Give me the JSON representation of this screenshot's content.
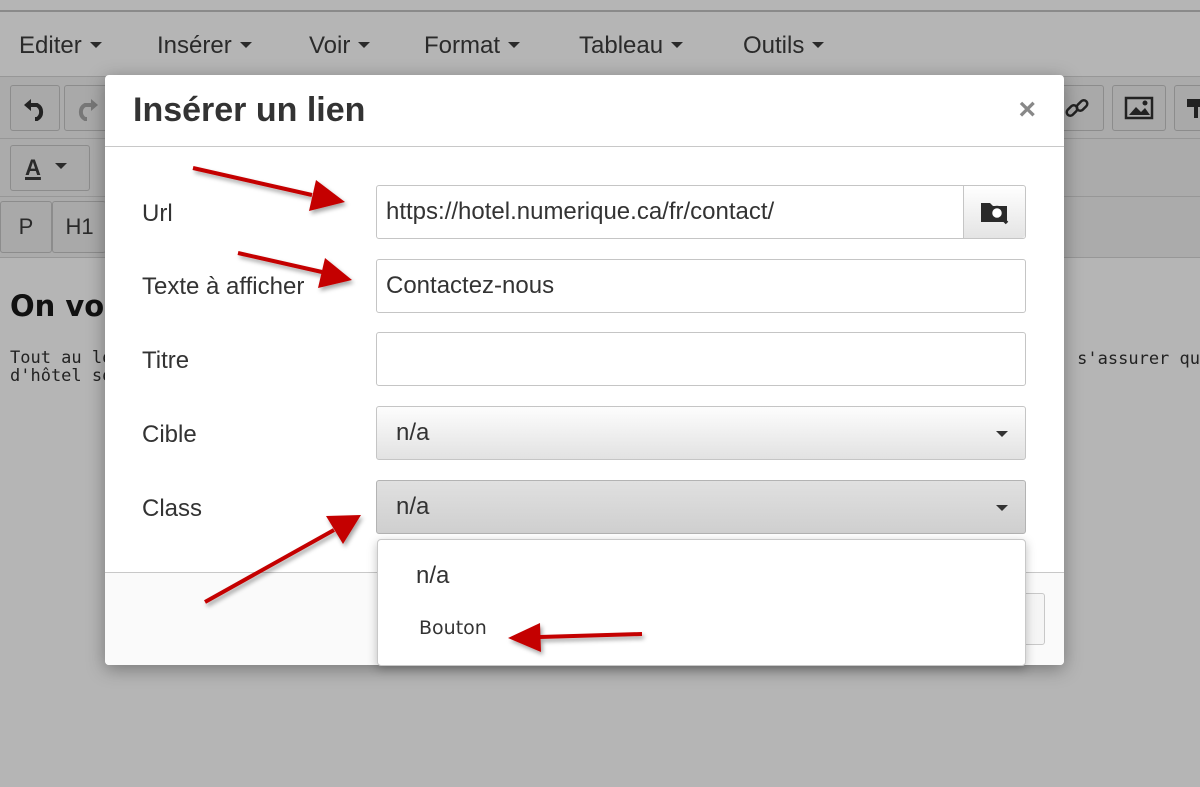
{
  "menubar": {
    "items": [
      {
        "label": "Editer"
      },
      {
        "label": "Insérer"
      },
      {
        "label": "Voir"
      },
      {
        "label": "Format"
      },
      {
        "label": "Tableau"
      },
      {
        "label": "Outils"
      }
    ]
  },
  "toolbar": {
    "text_color_label": "A",
    "block_formats": [
      "P",
      "H1"
    ]
  },
  "document": {
    "heading_partial": "On vo",
    "para_line1_partial": "Tout au lo",
    "para_line2_partial": "d'hôtel so",
    "para_right_partial": "s'assurer qu"
  },
  "dialog": {
    "title": "Insérer un lien",
    "close_glyph": "×",
    "fields": {
      "url": {
        "label": "Url",
        "value": "https://hotel.numerique.ca/fr/contact/"
      },
      "text": {
        "label": "Texte à afficher",
        "value": "Contactez-nous"
      },
      "title": {
        "label": "Titre",
        "value": ""
      },
      "target": {
        "label": "Cible",
        "value": "n/a"
      },
      "class": {
        "label": "Class",
        "value": "n/a"
      }
    },
    "class_options": [
      "n/a",
      "Bouton"
    ]
  },
  "icons": {
    "undo": "undo-icon",
    "redo": "redo-icon",
    "link": "link-icon",
    "image": "image-icon",
    "browse": "folder-search-icon"
  },
  "colors": {
    "annotation_arrow": "#c40000",
    "backdrop": "#b5b5b5"
  }
}
